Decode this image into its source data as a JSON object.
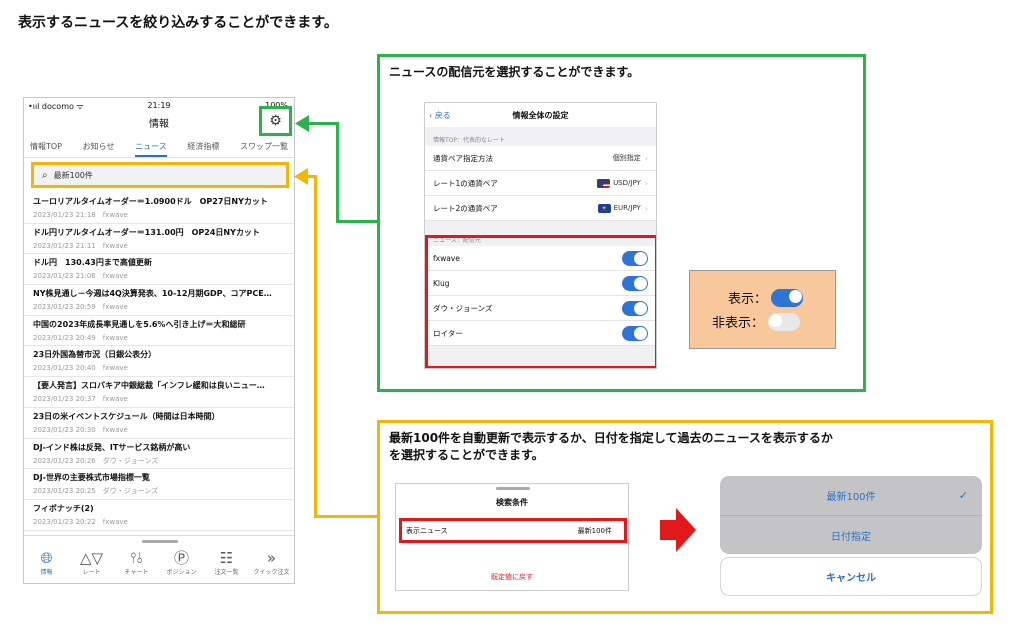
{
  "heading": "表示するニュースを絞り込みすることができます。",
  "phone": {
    "status": {
      "carrier": "•ııl docomo ᯤ",
      "time": "21:19",
      "battery": "100%"
    },
    "title": "情報",
    "tabs": [
      "情報TOP",
      "お知らせ",
      "ニュース",
      "経済指標",
      "スワップ一覧"
    ],
    "active_tab": 2,
    "search_text": "最新100件",
    "news": [
      {
        "title": "ユーロリアルタイムオーダー＝1.0900ドル　OP27日NYカット",
        "meta": "2023/01/23 21:18　fxwave"
      },
      {
        "title": "ドル円リアルタイムオーダー＝131.00円　OP24日NYカット",
        "meta": "2023/01/23 21:11　fxwave"
      },
      {
        "title": "ドル円　130.43円まで高値更新",
        "meta": "2023/01/23 21:06　fxwave"
      },
      {
        "title": "NY株見通し－今週は4Q決算発表、10-12月期GDP、コアPCE…",
        "meta": "2023/01/23 20:59　fxwave"
      },
      {
        "title": "中国の2023年成長率見通しを5.6%へ引き上げ＝大和総研",
        "meta": "2023/01/23 20:49　fxwave"
      },
      {
        "title": "23日外国為替市況（日銀公表分）",
        "meta": "2023/01/23 20:40　fxwave"
      },
      {
        "title": "【要人発言】スロバキア中銀総裁「インフレ緩和は良いニュー…",
        "meta": "2023/01/23 20:37　fxwave"
      },
      {
        "title": "23日の米イベントスケジュール（時間は日本時間）",
        "meta": "2023/01/23 20:30　fxwave"
      },
      {
        "title": "DJ-インド株は反発、ITサービス銘柄が高い",
        "meta": "2023/01/23 20:26　ダウ・ジョーンズ"
      },
      {
        "title": "DJ-世界の主要株式市場指標一覧",
        "meta": "2023/01/23 20:25　ダウ・ジョーンズ"
      },
      {
        "title": "フィボナッチ(2)",
        "meta": "2023/01/23 20:22　fxwave"
      }
    ],
    "tabbar": [
      "情報",
      "レート",
      "チャート",
      "ポジション",
      "注文一覧",
      "クイック注文"
    ]
  },
  "green_box": {
    "caption": "ニュースの配信元を選択することができます。",
    "settings": {
      "back": "戻る",
      "title": "情報全体の設定",
      "section1": "情報TOP：代表的なレート",
      "rows": [
        {
          "label": "通貨ペア指定方法",
          "value": "個別指定"
        },
        {
          "label": "レート1の通貨ペア",
          "value": "USD/JPY"
        },
        {
          "label": "レート2の通貨ペア",
          "value": "EUR/JPY"
        }
      ],
      "section2": "ニュース：配信元",
      "sources": [
        "fxwave",
        "Klug",
        "ダウ・ジョーンズ",
        "ロイター"
      ]
    },
    "legend": {
      "on": "表示：",
      "off": "非表示："
    }
  },
  "yellow_box": {
    "caption_line1": "最新100件を自動更新で表示するか、日付を指定して過去のニュースを表示するか",
    "caption_line2": "を選択することができます。",
    "search_cond": {
      "title": "検索条件",
      "row_label": "表示ニュース",
      "row_value": "最新100件",
      "reset": "既定値に戻す"
    },
    "picker": {
      "options": [
        "最新100件",
        "日付指定"
      ],
      "cancel": "キャンセル"
    }
  },
  "colors": {
    "green": "#2bb24c",
    "yellow": "#f2b705",
    "red": "#e1181c",
    "blue": "#2a6fc9",
    "toggle_on": "#2e74d6"
  }
}
